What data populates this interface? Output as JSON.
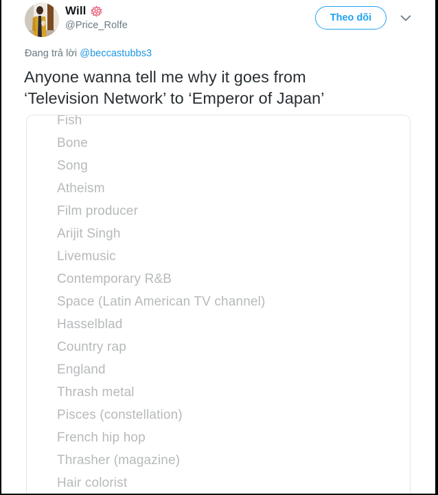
{
  "tweet": {
    "author": {
      "display_name": "Will",
      "badge_icon": "white-flower-emoji",
      "handle": "@Price_Rolfe",
      "avatar_icon": "user-avatar-photo"
    },
    "follow_button_label": "Theo dõi",
    "more_menu_icon": "chevron-down-icon",
    "reply_prefix": "Đang trả lời",
    "reply_mention": "@beccastubbs3",
    "body_line_1": "Anyone wanna tell me why it goes from",
    "body_line_2": "‘Television Network’ to ‘Emperor of Japan’"
  },
  "attachment": {
    "type": "screenshot-list",
    "items": [
      "Fish",
      "Bone",
      "Song",
      "Atheism",
      "Film producer",
      "Arijit Singh",
      "Livemusic",
      "Contemporary R&B",
      "Space (Latin American TV channel)",
      "Hasselblad",
      "Country rap",
      "England",
      "Thrash metal",
      "Pisces (constellation)",
      "French hip hop",
      "Thrasher (magazine)",
      "Hair colorist"
    ]
  },
  "colors": {
    "twitter_blue": "#1da1f2",
    "link_blue": "#1b95e0",
    "text_dark": "#292f33",
    "text_muted": "#697882",
    "list_text": "#b6b9bb",
    "card_border": "#e6e6e6"
  }
}
